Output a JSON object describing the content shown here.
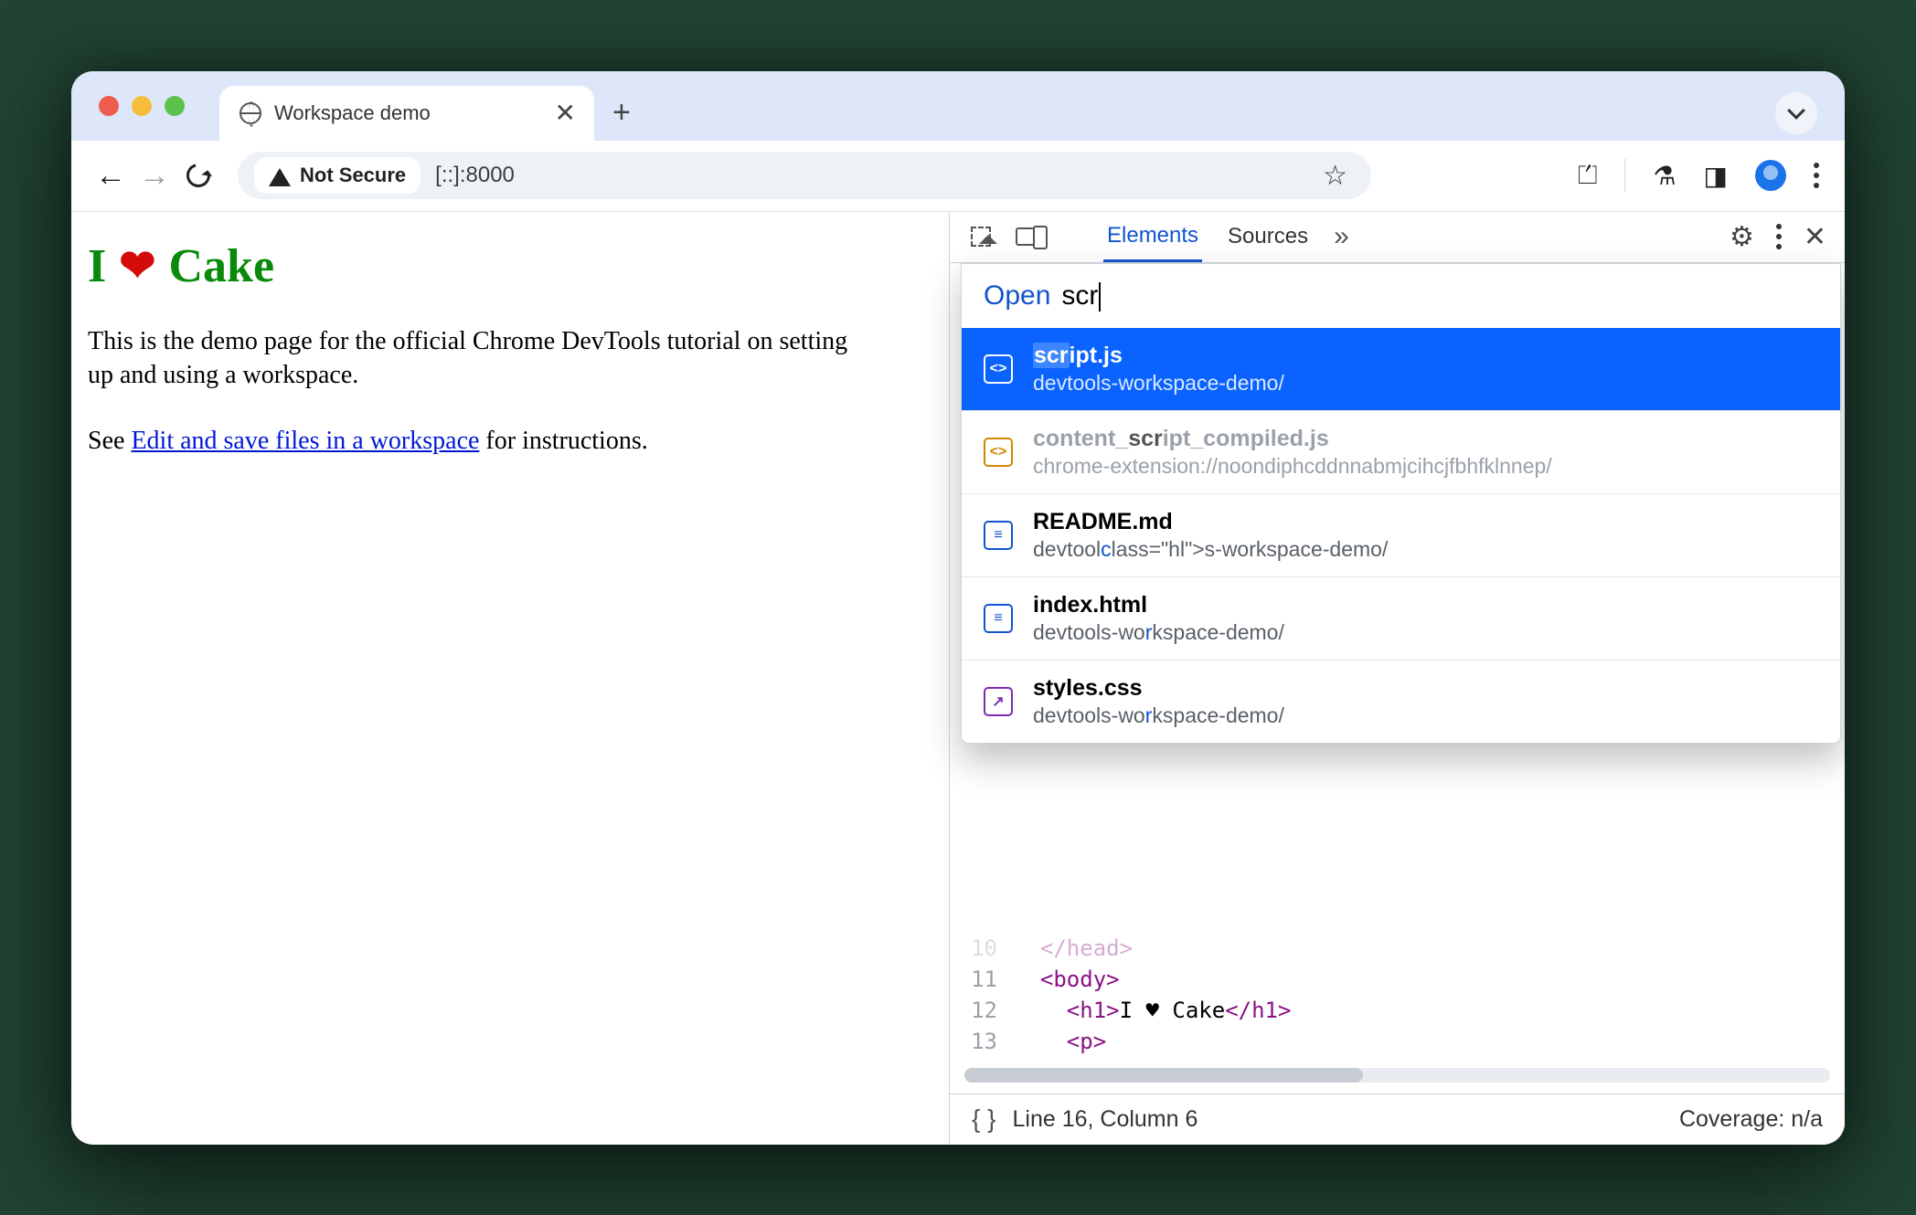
{
  "tab": {
    "title": "Workspace demo"
  },
  "toolbar": {
    "security_label": "Not Secure",
    "url": "[::]:8000"
  },
  "page": {
    "h1_i": "I",
    "h1_cake": "Cake",
    "para": "This is the demo page for the official Chrome DevTools tutorial on setting up and using a workspace.",
    "see_prefix": "See ",
    "link_text": "Edit and save files in a workspace",
    "see_suffix": " for instructions."
  },
  "devtools": {
    "tabs": {
      "elements": "Elements",
      "sources": "Sources"
    },
    "quickopen": {
      "prefix": "Open",
      "query": "scr",
      "items": [
        {
          "name_pre": "",
          "name_hl": "scr",
          "name_post": "ipt.js",
          "path": "devtools-workspace-demo/",
          "icon": "js",
          "selected": true,
          "dim": false
        },
        {
          "name_pre": "content_",
          "name_hl": "scr",
          "name_post": "ipt_compiled.js",
          "path": "chrome-extension://noondiphcddnnabmjcihcjfbhfklnnep/",
          "icon": "ext",
          "selected": false,
          "dim": true
        },
        {
          "name_pre": "README.md",
          "name_hl": "",
          "name_post": "",
          "path": "devtools-workspace-demo/",
          "icon": "doc",
          "selected": false,
          "dim": false,
          "path_hl_s": true
        },
        {
          "name_pre": "index.html",
          "name_hl": "",
          "name_post": "",
          "path": "devtools-workspace-demo/",
          "icon": "doc",
          "selected": false,
          "dim": false,
          "path_hl_r": true
        },
        {
          "name_pre": "styles.css",
          "name_hl": "",
          "name_post": "",
          "path": "devtools-workspace-demo/",
          "icon": "css",
          "selected": false,
          "dim": false,
          "path_hl_r": true
        }
      ]
    },
    "code": {
      "rows": [
        {
          "n": "10",
          "html": "</head>",
          "indent": 1,
          "faded": true
        },
        {
          "n": "11",
          "html": "<body>",
          "indent": 1
        },
        {
          "n": "12",
          "html": "<h1>I ♥ Cake</h1>",
          "indent": 2
        },
        {
          "n": "13",
          "html": "<p>",
          "indent": 2,
          "crop": true
        }
      ]
    },
    "status": {
      "pos": "Line 16, Column 6",
      "coverage": "Coverage: n/a"
    }
  }
}
